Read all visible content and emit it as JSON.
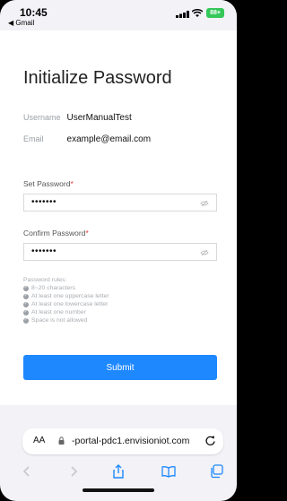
{
  "status_bar": {
    "time": "10:45",
    "back_app": "◀ Gmail",
    "battery": "88+"
  },
  "page": {
    "title": "Initialize Password",
    "username_label": "Username",
    "username_value": "UserManualTest",
    "email_label": "Email",
    "email_value": "example@email.com"
  },
  "set_password": {
    "label": "Set Password",
    "value": "•••••••"
  },
  "confirm_password": {
    "label": "Confirm Password",
    "value": "•••••••"
  },
  "rules": {
    "heading": "Password rules:",
    "items": [
      "8~20 characters",
      "At least one uppercase letter",
      "At least one lowercase letter",
      "At least one number",
      "Space is not allowed"
    ]
  },
  "submit_label": "Submit",
  "browser": {
    "aa_label": "AA",
    "url": "-portal-pdc1.envisioniot.com"
  },
  "colors": {
    "accent": "#1e88ff",
    "required": "#e53935"
  }
}
